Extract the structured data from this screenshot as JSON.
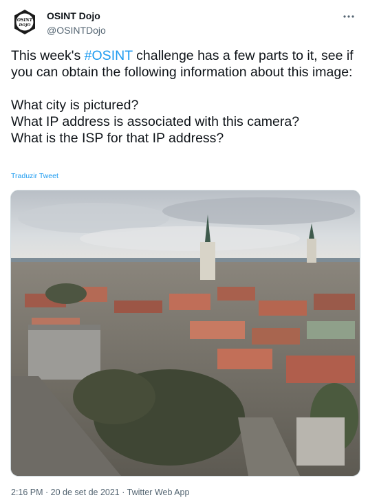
{
  "author": {
    "display_name": "OSINT Dojo",
    "handle": "@OSINTDojo",
    "avatar_icon": "osint-dojo-logo",
    "avatar_text_line1": "OSINT",
    "avatar_text_line2": "DOJO"
  },
  "more_icon": "ellipsis-icon",
  "tweet": {
    "text_before_hashtag": "This week's ",
    "hashtag": "#OSINT",
    "text_after_hashtag": " challenge has a few parts to it, see if you can obtain the following information about this image:\n\nWhat city is pictured?\nWhat IP address is associated with this camera?\nWhat is the ISP for that IP address?",
    "translate_label": "Traduzir Tweet",
    "media_description_icon": "city-webcam-photo"
  },
  "meta": {
    "time": "2:16 PM",
    "separator": " · ",
    "date": "20 de set de 2021",
    "source": "Twitter Web App"
  },
  "colors": {
    "link": "#1d9bf0",
    "secondary_text": "#536471",
    "primary_text": "#0f1419"
  }
}
